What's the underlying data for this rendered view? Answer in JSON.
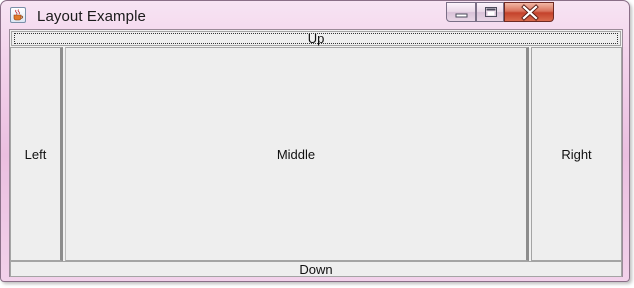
{
  "window": {
    "title": "Layout Example",
    "icons": {
      "app": "java-cup-icon",
      "minimize": "minimize-icon",
      "maximize": "maximize-icon",
      "close": "close-icon"
    }
  },
  "layout": {
    "north": "Up",
    "west": "Left",
    "center": "Middle",
    "east": "Right",
    "south": "Down"
  }
}
